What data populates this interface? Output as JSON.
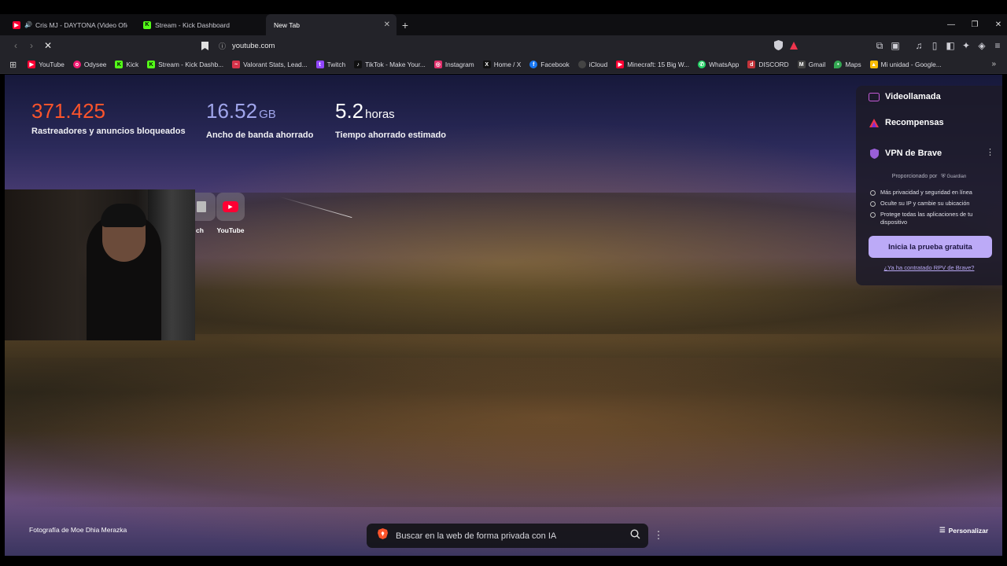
{
  "tabs": [
    {
      "title": "Cris MJ - DAYTONA (Video Oficial)",
      "favicon": "youtube-icon",
      "audio": true,
      "active": false
    },
    {
      "title": "Stream - Kick Dashboard",
      "favicon": "kick-icon",
      "audio": false,
      "active": false
    },
    {
      "title": "New Tab",
      "favicon": "",
      "audio": false,
      "active": true
    }
  ],
  "toolbar": {
    "url": "youtube.com"
  },
  "bookmarks": [
    {
      "label": "YouTube",
      "icon": "youtube-icon",
      "color": "#ff0033"
    },
    {
      "label": "Odysee",
      "icon": "odysee-icon",
      "color": "#ef1970"
    },
    {
      "label": "Kick",
      "icon": "kick-icon",
      "color": "#53fc18"
    },
    {
      "label": "Stream - Kick Dashb...",
      "icon": "kick-icon",
      "color": "#53fc18"
    },
    {
      "label": "Valorant Stats, Lead...",
      "icon": "tracker-icon",
      "color": "#d6334a"
    },
    {
      "label": "Twitch",
      "icon": "twitch-icon",
      "color": "#9146ff"
    },
    {
      "label": "TikTok - Make Your...",
      "icon": "tiktok-icon",
      "color": "#111111"
    },
    {
      "label": "Instagram",
      "icon": "instagram-icon",
      "color": "#e1306c"
    },
    {
      "label": "Home / X",
      "icon": "x-icon",
      "color": "#111111"
    },
    {
      "label": "Facebook",
      "icon": "facebook-icon",
      "color": "#1877f2"
    },
    {
      "label": "iCloud",
      "icon": "apple-icon",
      "color": "#444444"
    },
    {
      "label": "Minecraft: 15 Big W...",
      "icon": "youtube-icon",
      "color": "#ff0033"
    },
    {
      "label": "WhatsApp",
      "icon": "whatsapp-icon",
      "color": "#25d366"
    },
    {
      "label": "DISCORD",
      "icon": "discord-icon",
      "color": "#c3333a"
    },
    {
      "label": "Gmail",
      "icon": "gmail-icon",
      "color": "#444444"
    },
    {
      "label": "Maps",
      "icon": "maps-icon",
      "color": "#34a853"
    },
    {
      "label": "Mi unidad - Google...",
      "icon": "drive-icon",
      "color": "#fbbc04"
    }
  ],
  "stats": [
    {
      "value": "371.425",
      "unit": "",
      "label": "Rastreadores y anuncios bloqueados",
      "color": "#fb542b"
    },
    {
      "value": "16.52",
      "unit": "GB",
      "label": "Ancho de banda ahorrado",
      "color": "#a0a5eb"
    },
    {
      "value": "5.2",
      "unit": "horas",
      "label": "Tiempo ahorrado estimado",
      "color": "#ffffff"
    }
  ],
  "tiles": [
    {
      "label": "ch",
      "icon": "twitch-icon"
    },
    {
      "label": "YouTube",
      "icon": "youtube-icon"
    }
  ],
  "panel": {
    "videocall": "Videollamada",
    "rewards": "Recompensas",
    "vpn_title": "VPN de Brave",
    "provided_by": "Proporcionado por",
    "provider": "Guardian",
    "bullets": [
      "Más privacidad y seguridad en línea",
      "Oculte su IP y cambie su ubicación",
      "Protege todas las aplicaciones de tu dispositivo"
    ],
    "trial_button": "Inicia la prueba gratuita",
    "trial_link": "¿Ya ha contratado RPV de Brave?"
  },
  "footer": {
    "photo_credit": "Fotografía de Moe Dhia Merazka",
    "search_placeholder": "Buscar en la web de forma privada con IA",
    "customize": "Personalizar"
  },
  "colors": {
    "accent": "#bcaaf7",
    "brave_orange": "#fb542b"
  }
}
